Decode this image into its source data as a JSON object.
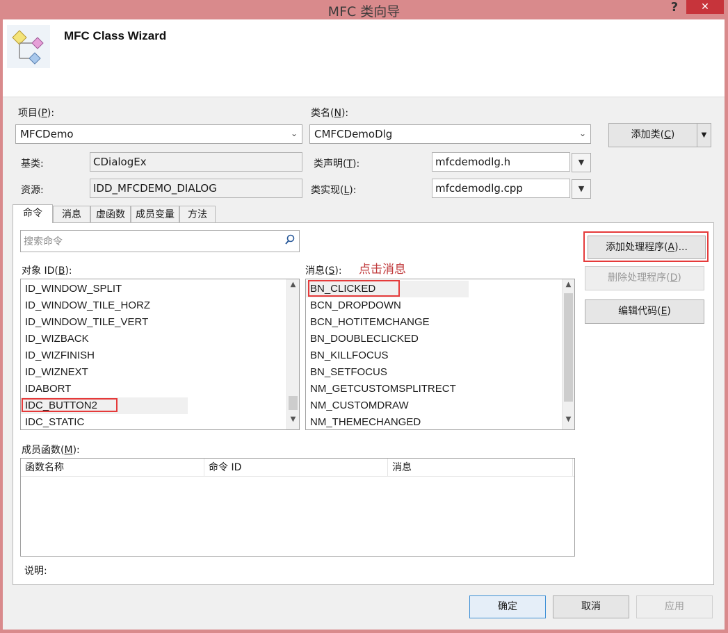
{
  "window": {
    "title": "MFC 类向导",
    "help": "?",
    "close": "✕"
  },
  "banner": {
    "title": "MFC Class Wizard"
  },
  "project": {
    "label_pre": "项目(",
    "label_key": "P",
    "label_post": "):",
    "value": "MFCDemo"
  },
  "classname": {
    "label_pre": "类名(",
    "label_key": "N",
    "label_post": "):",
    "value": "CMFCDemoDlg"
  },
  "add_class": {
    "label_pre": "添加类(",
    "label_key": "C",
    "label_post": ")"
  },
  "base_class": {
    "label": "基类:",
    "value": "CDialogEx"
  },
  "resource": {
    "label": "资源:",
    "value": "IDD_MFCDEMO_DIALOG"
  },
  "class_decl": {
    "label_pre": "类声明(",
    "label_key": "T",
    "label_post": "):",
    "value": "mfcdemodlg.h"
  },
  "class_impl": {
    "label_pre": "类实现(",
    "label_key": "L",
    "label_post": "):",
    "value": "mfcdemodlg.cpp"
  },
  "tabs": [
    {
      "label": "命令",
      "active": true
    },
    {
      "label": "消息"
    },
    {
      "label": "虚函数"
    },
    {
      "label": "成员变量"
    },
    {
      "label": "方法"
    }
  ],
  "search": {
    "placeholder": "搜索命令"
  },
  "object_ids": {
    "label_pre": "对象 ID(",
    "label_key": "B",
    "label_post": "):",
    "items": [
      "ID_WINDOW_SPLIT",
      "ID_WINDOW_TILE_HORZ",
      "ID_WINDOW_TILE_VERT",
      "ID_WIZBACK",
      "ID_WIZFINISH",
      "ID_WIZNEXT",
      "IDABORT",
      "IDC_BUTTON2",
      "IDC_STATIC"
    ],
    "selected": "IDC_BUTTON2"
  },
  "messages": {
    "label_pre": "消息(",
    "label_key": "S",
    "label_post": "):",
    "annotation": "点击消息",
    "items": [
      "BN_CLICKED",
      "BCN_DROPDOWN",
      "BCN_HOTITEMCHANGE",
      "BN_DOUBLECLICKED",
      "BN_KILLFOCUS",
      "BN_SETFOCUS",
      "NM_GETCUSTOMSPLITRECT",
      "NM_CUSTOMDRAW",
      "NM_THEMECHANGED"
    ],
    "selected": "BN_CLICKED"
  },
  "actions": {
    "add_handler": {
      "pre": "添加处理程序(",
      "key": "A",
      "post": ")..."
    },
    "delete_handler": {
      "pre": "删除处理程序(",
      "key": "D",
      "post": ")"
    },
    "edit_code": {
      "pre": "编辑代码(",
      "key": "E",
      "post": ")"
    }
  },
  "member_functions": {
    "label_pre": "成员函数(",
    "label_key": "M",
    "label_post": "):",
    "columns": [
      "函数名称",
      "命令 ID",
      "消息"
    ]
  },
  "description": {
    "label": "说明:"
  },
  "footer": {
    "ok": "确定",
    "cancel": "取消",
    "apply": "应用"
  },
  "colors": {
    "titlebar": "#d98a8c",
    "close": "#c7343b",
    "highlight": "#e53a3a"
  }
}
